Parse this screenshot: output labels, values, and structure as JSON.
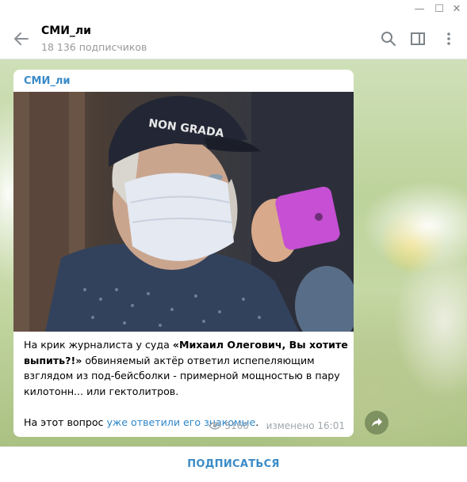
{
  "window": {
    "minimize_glyph": "—",
    "maximize_glyph": "☐",
    "close_glyph": "✕"
  },
  "header": {
    "title": "СМИ_ли",
    "subtitle": "18 136 подписчиков",
    "icons": [
      "back-arrow-icon",
      "search-icon",
      "sidebar-toggle-icon",
      "more-vertical-icon"
    ]
  },
  "message": {
    "author": "СМИ_ли",
    "photo_cap_text": "NON GRADA",
    "text_intro": "На крик журналиста у суда ",
    "text_bold": "«Михаил Олегович, Вы хотите выпить?!»",
    "text_rest": " обвиняемый актёр ответил испепеляющим взглядом из под-бейсболки - примерной мощностью в пару килотонн... или гектолитров.",
    "text2_intro": "На этот вопрос ",
    "text2_link": "уже ответили его знакомые",
    "text2_end": ".",
    "views": "5160",
    "edited_time": "изменено 16:01"
  },
  "footer": {
    "subscribe_label": "ПОДПИСАТЬСЯ"
  },
  "colors": {
    "accent": "#3a8bc7",
    "link": "#2e87c9",
    "meta": "#a0a7ad",
    "subtitle": "#999999"
  }
}
